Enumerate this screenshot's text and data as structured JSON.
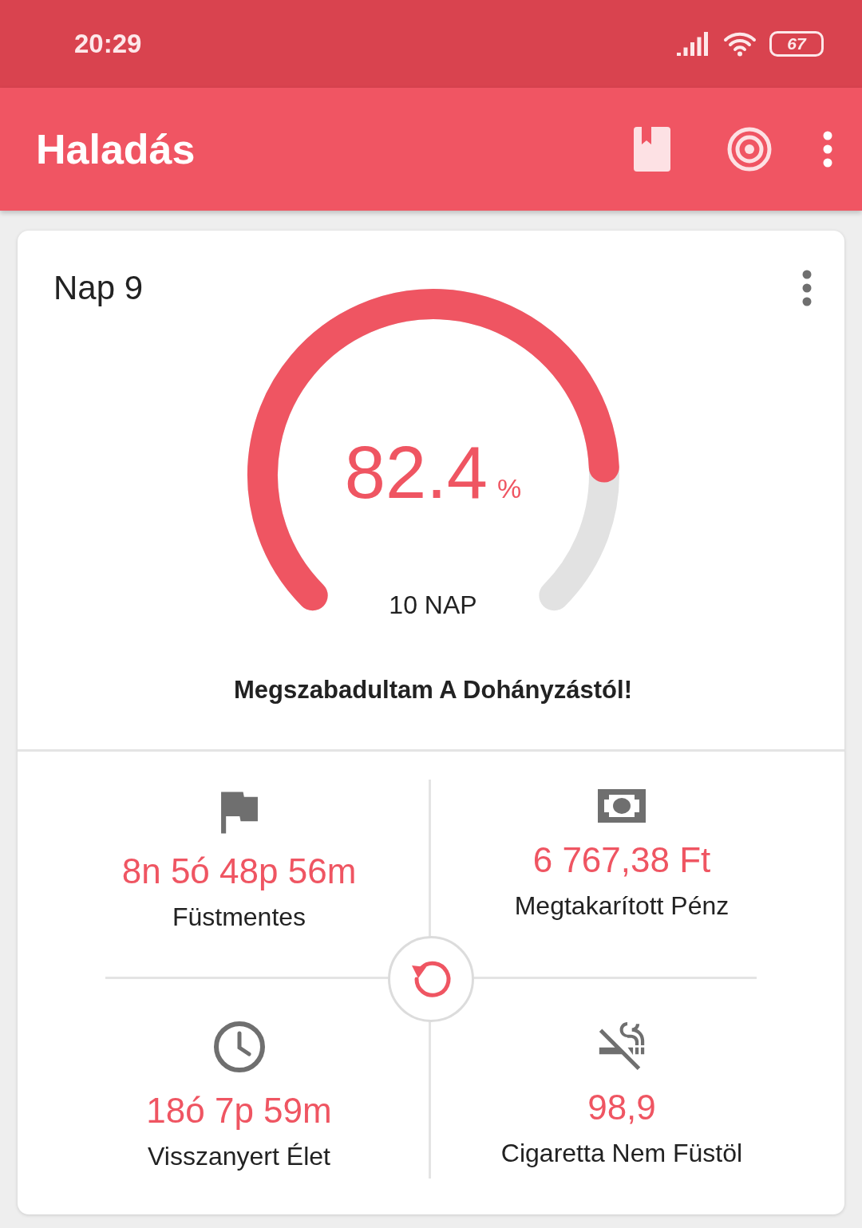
{
  "status_bar": {
    "time": "20:29",
    "battery": "67"
  },
  "app_bar": {
    "title": "Haladás"
  },
  "progress_card": {
    "title": "Nap 9",
    "gauge": {
      "value": "82.4",
      "unit": "%",
      "caption": "10 NAP"
    },
    "message": "Megszabadultam A Dohányzástól!"
  },
  "stats": [
    {
      "kind": "flag",
      "value": "8n 5ó 48p 56m",
      "label": "Füstmentes"
    },
    {
      "kind": "money",
      "value": "6 767,38 Ft",
      "label": "Megtakarított Pénz"
    },
    {
      "kind": "clock",
      "value": "18ó 7p 59m",
      "label": "Visszanyert Élet"
    },
    {
      "kind": "no-smoking",
      "value": "98,9",
      "label": "Cigaretta Nem Füstöl"
    }
  ]
}
